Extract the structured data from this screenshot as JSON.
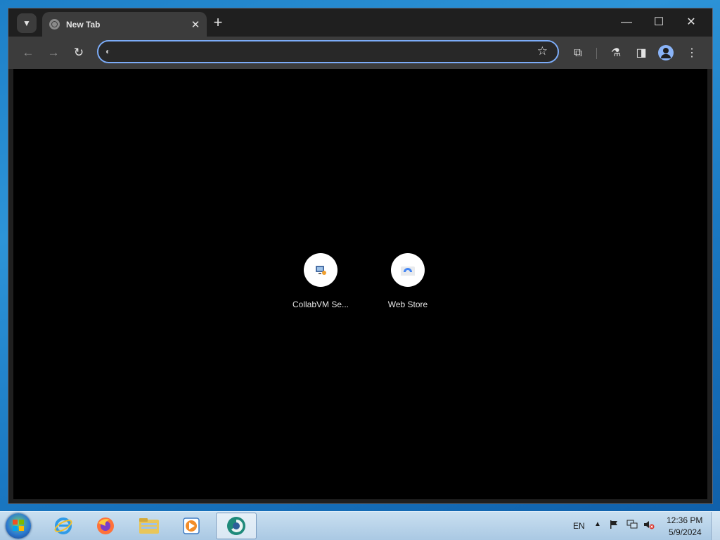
{
  "browser": {
    "tab": {
      "title": "New Tab"
    },
    "omnibox": {
      "value": "",
      "placeholder": ""
    },
    "window_controls": {
      "minimize": "—",
      "maximize": "☐",
      "close": "✕"
    }
  },
  "new_tab_page": {
    "shortcuts": [
      {
        "label": "CollabVM Se..."
      },
      {
        "label": "Web Store"
      }
    ]
  },
  "taskbar": {
    "apps": [
      "internet-explorer",
      "firefox",
      "file-explorer",
      "media-player",
      "browser"
    ],
    "language": "EN",
    "time": "12:36 PM",
    "date": "5/9/2024"
  },
  "colors": {
    "omnibox_focus": "#7cacf8",
    "ntp_background": "#000000",
    "tab_active": "#3c3c3c",
    "toolbar": "#3c3c3c",
    "frame": "#1f1f1f"
  }
}
